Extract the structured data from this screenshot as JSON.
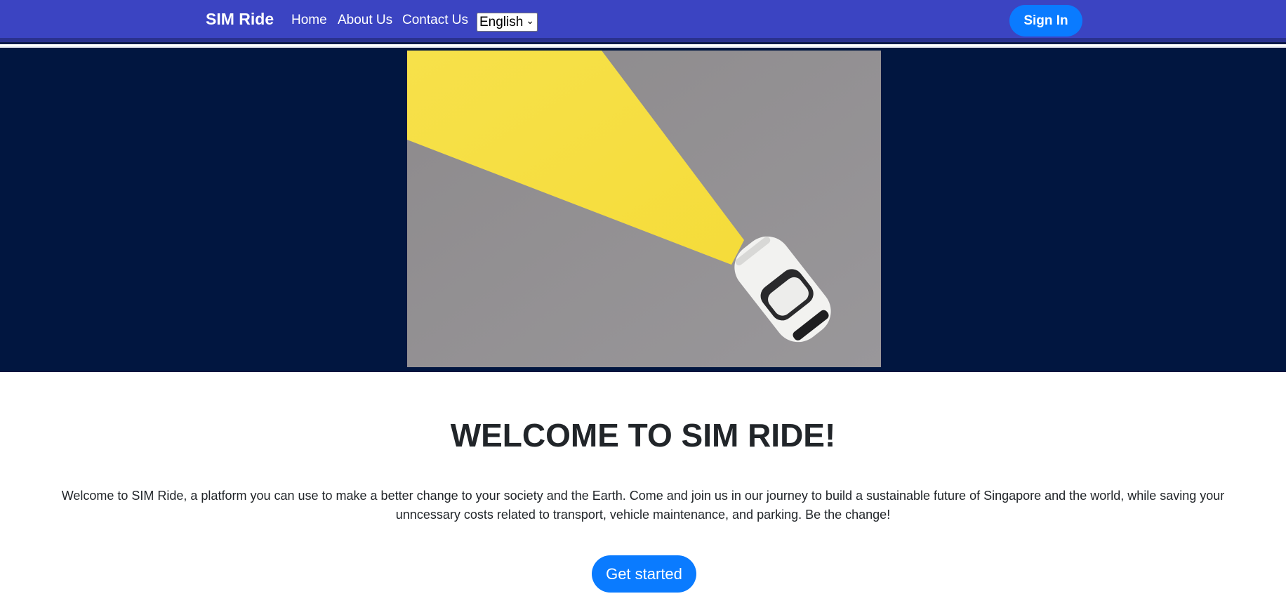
{
  "navbar": {
    "brand": "SIM Ride",
    "links": [
      "Home",
      "About Us",
      "Contact Us"
    ],
    "language": "English",
    "signin_label": "Sign In"
  },
  "hero": {
    "image_icon": "car-headlight-illustration"
  },
  "main": {
    "title": "WELCOME TO SIM RIDE!",
    "description": "Welcome to SIM Ride, a platform you can use to make a better change to your society and the Earth. Come and join us in our journey to build a sustainable future of Singapore and the world, while saving your unncessary costs related to transport, vehicle maintenance, and parking. Be the change!",
    "cta_label": "Get started"
  },
  "colors": {
    "navbar": "#3b44c2",
    "hero_bg": "#011640",
    "button": "#0a7bff",
    "beam": "#f7e04a"
  }
}
